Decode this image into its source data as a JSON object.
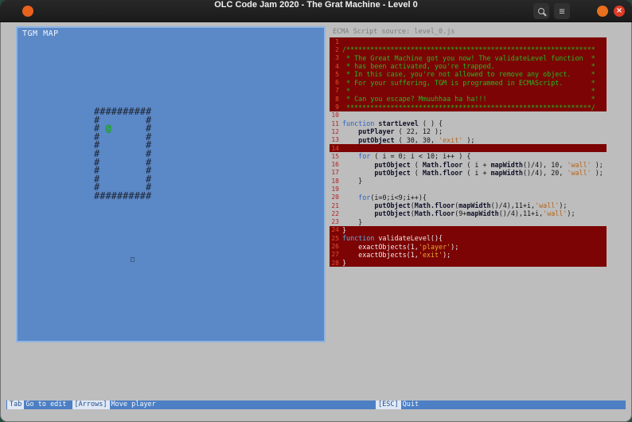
{
  "window": {
    "title": "OLC Code Jam 2020 - The Grat Machine - Level 0",
    "icons": {
      "menu_glyph": "≡",
      "close_glyph": "×"
    }
  },
  "map_panel": {
    "title": "TGM MAP",
    "rows": [
      "##########",
      "#        #",
      "# @      #",
      "#        #",
      "#        #",
      "#        #",
      "#        #",
      "#        #",
      "#        #",
      "#        #",
      "##########"
    ],
    "player_glyph": "@",
    "exit_glyph": "□"
  },
  "code_panel": {
    "header": "ECMA Script source: level_0.js",
    "lines": [
      {
        "n": "1",
        "red": true,
        "seg": []
      },
      {
        "n": "2",
        "red": true,
        "seg": [
          {
            "t": "/**************************************************************",
            "c": "cmt"
          }
        ]
      },
      {
        "n": "3",
        "red": true,
        "seg": [
          {
            "t": " * The Great Machine got you now! The validateLevel function  *",
            "c": "cmt"
          }
        ]
      },
      {
        "n": "4",
        "red": true,
        "seg": [
          {
            "t": " * has been activated, you're trapped.                        *",
            "c": "cmt"
          }
        ]
      },
      {
        "n": "5",
        "red": true,
        "seg": [
          {
            "t": " * In this case, you're not allowed to remove any object.     *",
            "c": "cmt"
          }
        ]
      },
      {
        "n": "6",
        "red": true,
        "seg": [
          {
            "t": " * For your suffering, TGM is programmed in ECMAScript.       *",
            "c": "cmt"
          }
        ]
      },
      {
        "n": "7",
        "red": true,
        "seg": [
          {
            "t": " *                                                            *",
            "c": "cmt"
          }
        ]
      },
      {
        "n": "8",
        "red": true,
        "seg": [
          {
            "t": " * Can you escape? Mmuuhhaa ha ha!!!                          *",
            "c": "cmt"
          }
        ]
      },
      {
        "n": "9",
        "red": true,
        "seg": [
          {
            "t": " *************************************************************/",
            "c": "cmt"
          }
        ]
      },
      {
        "n": "10",
        "seg": []
      },
      {
        "n": "11",
        "seg": [
          {
            "t": "function",
            "c": "kw"
          },
          {
            "t": " ",
            "c": "txt"
          },
          {
            "t": "startLevel",
            "c": "fn"
          },
          {
            "t": " ( ) {",
            "c": "txt"
          }
        ]
      },
      {
        "n": "12",
        "seg": [
          {
            "t": "    ",
            "c": "txt"
          },
          {
            "t": "putPlayer",
            "c": "fn"
          },
          {
            "t": " ( 22, 12 );",
            "c": "txt"
          }
        ]
      },
      {
        "n": "13",
        "seg": [
          {
            "t": "    ",
            "c": "txt"
          },
          {
            "t": "putObject",
            "c": "fn"
          },
          {
            "t": " ( 30, 30, ",
            "c": "txt"
          },
          {
            "t": "'exit'",
            "c": "str"
          },
          {
            "t": " );",
            "c": "txt"
          }
        ]
      },
      {
        "n": "14",
        "red": true,
        "seg": []
      },
      {
        "n": "15",
        "seg": [
          {
            "t": "    ",
            "c": "txt"
          },
          {
            "t": "for",
            "c": "kw"
          },
          {
            "t": " ( i = 0; i < 10; i++ ) {",
            "c": "txt"
          }
        ]
      },
      {
        "n": "16",
        "seg": [
          {
            "t": "        ",
            "c": "txt"
          },
          {
            "t": "putObject",
            "c": "fn"
          },
          {
            "t": " ( ",
            "c": "txt"
          },
          {
            "t": "Math.floor",
            "c": "fn"
          },
          {
            "t": " ( i + ",
            "c": "txt"
          },
          {
            "t": "mapWidth",
            "c": "fn"
          },
          {
            "t": "()/4), 10, ",
            "c": "txt"
          },
          {
            "t": "'wall'",
            "c": "str"
          },
          {
            "t": " );",
            "c": "txt"
          }
        ]
      },
      {
        "n": "17",
        "seg": [
          {
            "t": "        ",
            "c": "txt"
          },
          {
            "t": "putObject",
            "c": "fn"
          },
          {
            "t": " ( ",
            "c": "txt"
          },
          {
            "t": "Math.floor",
            "c": "fn"
          },
          {
            "t": " ( i + ",
            "c": "txt"
          },
          {
            "t": "mapWidth",
            "c": "fn"
          },
          {
            "t": "()/4), 20, ",
            "c": "txt"
          },
          {
            "t": "'wall'",
            "c": "str"
          },
          {
            "t": " );",
            "c": "txt"
          }
        ]
      },
      {
        "n": "18",
        "seg": [
          {
            "t": "    }",
            "c": "txt"
          }
        ]
      },
      {
        "n": "19",
        "seg": []
      },
      {
        "n": "20",
        "seg": [
          {
            "t": "    ",
            "c": "txt"
          },
          {
            "t": "for",
            "c": "kw"
          },
          {
            "t": "(i=0;i<9;i++){",
            "c": "txt"
          }
        ]
      },
      {
        "n": "21",
        "seg": [
          {
            "t": "        ",
            "c": "txt"
          },
          {
            "t": "putObject",
            "c": "fn"
          },
          {
            "t": "(",
            "c": "txt"
          },
          {
            "t": "Math.floor",
            "c": "fn"
          },
          {
            "t": "(",
            "c": "txt"
          },
          {
            "t": "mapWidth",
            "c": "fn"
          },
          {
            "t": "()/4),11+i,",
            "c": "txt"
          },
          {
            "t": "'wall'",
            "c": "str"
          },
          {
            "t": ");",
            "c": "txt"
          }
        ]
      },
      {
        "n": "22",
        "seg": [
          {
            "t": "        ",
            "c": "txt"
          },
          {
            "t": "putObject",
            "c": "fn"
          },
          {
            "t": "(",
            "c": "txt"
          },
          {
            "t": "Math.floor",
            "c": "fn"
          },
          {
            "t": "(9+",
            "c": "txt"
          },
          {
            "t": "mapWidth",
            "c": "fn"
          },
          {
            "t": "()/4),11+i,",
            "c": "txt"
          },
          {
            "t": "'wall'",
            "c": "str"
          },
          {
            "t": ");",
            "c": "txt"
          }
        ]
      },
      {
        "n": "23",
        "seg": [
          {
            "t": "    }",
            "c": "txt"
          }
        ]
      },
      {
        "n": "24",
        "red": true,
        "seg": [
          {
            "t": "}",
            "c": "wht"
          }
        ]
      },
      {
        "n": "25",
        "red": true,
        "seg": [
          {
            "t": "function",
            "c": "kwr"
          },
          {
            "t": " validateLevel(){",
            "c": "wht"
          }
        ]
      },
      {
        "n": "26",
        "red": true,
        "seg": [
          {
            "t": "    exactObjects(1,",
            "c": "wht"
          },
          {
            "t": "'player'",
            "c": "strr"
          },
          {
            "t": ");",
            "c": "wht"
          }
        ]
      },
      {
        "n": "27",
        "red": true,
        "seg": [
          {
            "t": "    exactObjects(1,",
            "c": "wht"
          },
          {
            "t": "'exit'",
            "c": "strr"
          },
          {
            "t": ");",
            "c": "wht"
          }
        ]
      },
      {
        "n": "28",
        "red": true,
        "seg": [
          {
            "t": "}",
            "c": "wht"
          }
        ]
      }
    ]
  },
  "status_bar": {
    "left_items": [
      {
        "key": "Tab",
        "label": "Go to edit"
      },
      {
        "key": "[Arrows]",
        "label": "Move player"
      }
    ],
    "middle_item": {
      "key": "[ESC]",
      "label": "Quit"
    }
  },
  "colors": {
    "map_blue": "#5b88c6",
    "map_border_blue": "#8fb4e2",
    "protected_red": "#7c0404",
    "status_bar_blue": "#4d7fc4",
    "comment_green": "#25b825",
    "keyword_blue": "#2f62c8",
    "string_orange": "#b5651d",
    "line_number_red": "#b32424",
    "player_green": "#13a513"
  }
}
